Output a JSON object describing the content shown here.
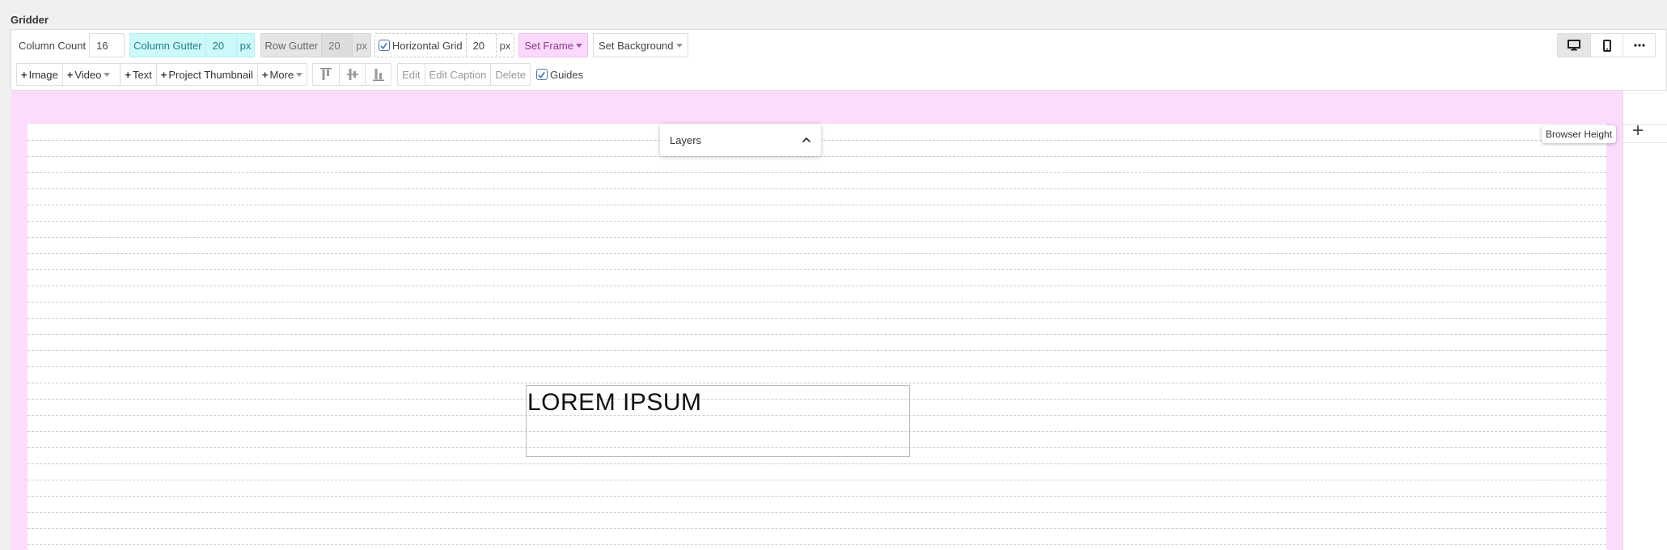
{
  "app": {
    "title": "Gridder"
  },
  "toolbar": {
    "column_count_label": "Column Count",
    "column_count_value": "16",
    "column_gutter_label": "Column Gutter",
    "column_gutter_value": "20",
    "column_gutter_unit": "px",
    "row_gutter_label": "Row Gutter",
    "row_gutter_value": "20",
    "row_gutter_unit": "px",
    "horizontal_grid_label": "Horizontal Grid",
    "horizontal_grid_checked": true,
    "horizontal_grid_value": "20",
    "horizontal_grid_unit": "px",
    "set_frame_label": "Set Frame",
    "set_background_label": "Set Background",
    "add_image_label": "Image",
    "add_video_label": "Video",
    "add_text_label": "Text",
    "add_project_thumbnail_label": "Project Thumbnail",
    "add_more_label": "More",
    "edit_label": "Edit",
    "edit_caption_label": "Edit Caption",
    "delete_label": "Delete",
    "guides_label": "Guides",
    "guides_checked": true
  },
  "view_toggle": {
    "active": "desktop"
  },
  "canvas": {
    "text_block": "LOREM IPSUM",
    "layers_label": "Layers",
    "browser_height_label": "Browser Height"
  },
  "colors": {
    "frame": "#fcdcfc",
    "column_gutter_bg": "#ccfafa",
    "row_gutter_bg": "#e5e5e5",
    "set_frame_bg": "#fcd9fc",
    "checkbox": "#4a78b5"
  },
  "icons": {
    "plus": "plus-icon",
    "caret": "caret-down-icon",
    "check": "check-icon",
    "align_top": "align-top-icon",
    "align_middle": "align-middle-icon",
    "align_bottom": "align-bottom-icon",
    "desktop": "desktop-icon",
    "mobile": "mobile-icon",
    "more": "ellipsis-icon",
    "chevron_up": "chevron-up-icon"
  }
}
